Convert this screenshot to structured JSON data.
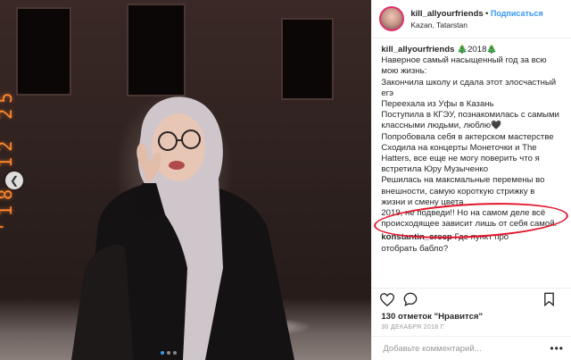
{
  "header": {
    "username": "kill_allyourfriends",
    "separator": "•",
    "follow_label": "Подписаться",
    "location": "Kazan, Tatarstan"
  },
  "caption": {
    "username": "kill_allyourfriends",
    "title_suffix": "🎄2018🎄",
    "lines": [
      "Наверное самый насыщенный год за всю",
      "мою жизнь:",
      "Закончила школу и сдала этот злосчастный",
      "егэ",
      "Переехала из Уфы в Казань",
      "Поступила в КГЭУ, познакомилась с самыми",
      "классными людьми, люблю🖤",
      "Попробовала себя в актерском мастерстве",
      "Сходила на концерты Монеточки и The",
      "Hatters, все еще не могу поверить что я",
      "встретила Юру Музыченко",
      "Решилась на максмальные перемены во",
      "внешности, самую короткую стрижку в",
      "жизни и смену цвета"
    ],
    "circled_lines": [
      "2019, не подведи!! Но на самом деле всё",
      "происходящее зависит лишь от себя самой."
    ]
  },
  "comment": {
    "username": "konstantin_creep",
    "text_1": "Где пункт про",
    "text_2": "отобрать бабло?"
  },
  "actions": {
    "like_icon": "heart-icon",
    "comment_icon": "comment-icon",
    "save_icon": "bookmark-icon"
  },
  "likes_text": "130 отметок \"Нравится\"",
  "date_text": "30 ДЕКАБРЯ 2018 Г.",
  "add_comment": {
    "placeholder": "Добавьте комментарий...",
    "more_label": "•••"
  },
  "photo": {
    "timestamp_stamp": "'18 12 25",
    "nav_prev_icon": "chevron-left-icon",
    "dots_count": 3,
    "active_dot": 0
  },
  "colors": {
    "accent": "#3897f0",
    "highlight_ellipse": "#e3142b",
    "stamp": "#ff8a30"
  }
}
